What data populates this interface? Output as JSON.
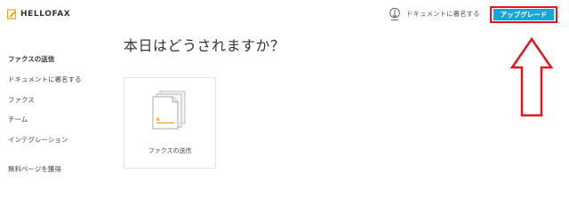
{
  "header": {
    "logo_text": "HELLOFAX",
    "sign_link_label": "ドキュメントに署名する",
    "upgrade_label": "アップグレード"
  },
  "sidebar": {
    "items": [
      {
        "label": "ファクスの送信",
        "active": true
      },
      {
        "label": "ドキュメントに署名する",
        "active": false
      },
      {
        "label": "ファクス",
        "active": false
      },
      {
        "label": "チーム",
        "active": false
      },
      {
        "label": "インテグレーション",
        "active": false
      },
      {
        "label": "無料ページを獲得",
        "active": false
      }
    ]
  },
  "main": {
    "title": "本日はどうされますか？",
    "cards": [
      {
        "label": "ファクスの送信",
        "icon": "fax-document-icon"
      }
    ]
  },
  "colors": {
    "accent": "#15a6dc",
    "highlight_red": "#e8141b",
    "logo_orange": "#f0a020"
  }
}
